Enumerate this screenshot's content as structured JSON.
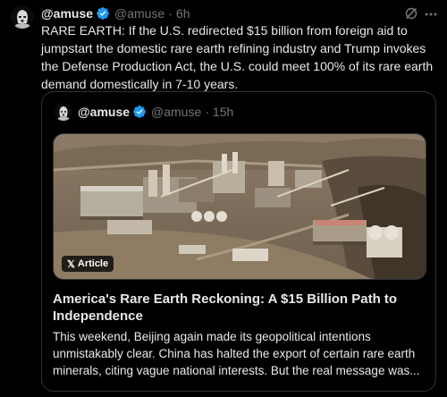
{
  "post": {
    "author_name": "@amuse",
    "author_handle": "@amuse",
    "separator": "·",
    "time": "6h",
    "text": "RARE EARTH: If the U.S. redirected $15 billion from foreign aid to jumpstart the domestic rare earth refining industry and Trump invokes the Defense Production Act, the U.S. could meet 100% of its rare earth demand domestically in 7-10 years."
  },
  "quoted_post": {
    "author_name": "@amuse",
    "author_handle": "@amuse",
    "separator": "·",
    "time": "15h",
    "article_badge": "Article",
    "article_title": "America's Rare Earth Reckoning: A $15 Billion Path to Independence",
    "article_excerpt": "This weekend, Beijing again made its geopolitical intentions unmistakably clear. China has halted the export of certain rare earth minerals, citing vague national interests. But the real message was..."
  },
  "colors": {
    "background": "#000000",
    "text_primary": "#e7e9ea",
    "text_secondary": "#71767b",
    "border": "#2f3336",
    "verified_badge": "#1d9bf0"
  },
  "icons": {
    "avatar": "storm-trooper-avatar",
    "verified": "verified-badge-icon",
    "grok": "grok-icon",
    "more": "more-icon",
    "x_logo": "x-logo-icon"
  }
}
